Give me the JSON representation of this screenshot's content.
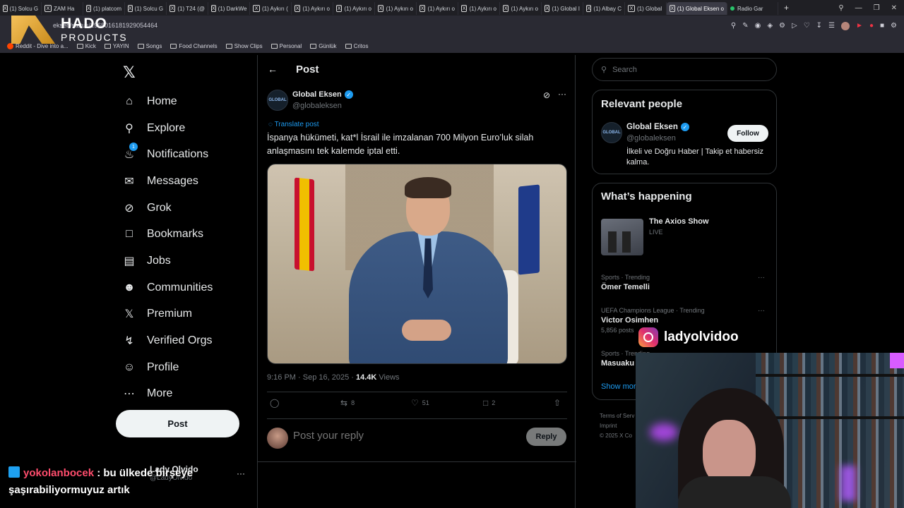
{
  "browser": {
    "tabs": [
      {
        "label": "(1) Solcu G"
      },
      {
        "label": "ZAM Ha"
      },
      {
        "label": "(1) platcom"
      },
      {
        "label": "(1) Solcu G"
      },
      {
        "label": "(1) T24 (@"
      },
      {
        "label": "(1) DarkWe"
      },
      {
        "label": "(1) Aykırı ("
      },
      {
        "label": "(1) Aykırı o"
      },
      {
        "label": "(1) Aykırı o"
      },
      {
        "label": "(1) Aykırı o"
      },
      {
        "label": "(1) Aykırı o"
      },
      {
        "label": "(1) Aykırı o"
      },
      {
        "label": "(1) Aykırı o"
      },
      {
        "label": "(1) Global I"
      },
      {
        "label": "(1) Albay C"
      },
      {
        "label": "(1) Global"
      },
      {
        "label": "(1) Global Eksen o"
      },
      {
        "label": "Radio Gar"
      }
    ],
    "url": "eksen/status/1968016181929054464",
    "bookmarks": [
      "Reddit - Dive into a...",
      "Kick",
      "YAYIN",
      "Songs",
      "Food Channels",
      "Show Clips",
      "Personal",
      "Günlük",
      "Critos"
    ]
  },
  "logo": {
    "line1": "HADO",
    "line2": "PRODUCTS"
  },
  "nav": {
    "items": [
      {
        "label": "Home",
        "icon": "home-icon"
      },
      {
        "label": "Explore",
        "icon": "search-icon"
      },
      {
        "label": "Notifications",
        "icon": "bell-icon"
      },
      {
        "label": "Messages",
        "icon": "envelope-icon"
      },
      {
        "label": "Grok",
        "icon": "grok-icon"
      },
      {
        "label": "Bookmarks",
        "icon": "bookmark-icon"
      },
      {
        "label": "Jobs",
        "icon": "briefcase-icon"
      },
      {
        "label": "Communities",
        "icon": "people-icon"
      },
      {
        "label": "Premium",
        "icon": "x-icon"
      },
      {
        "label": "Verified Orgs",
        "icon": "bolt-icon"
      },
      {
        "label": "Profile",
        "icon": "person-icon"
      },
      {
        "label": "More",
        "icon": "more-circle-icon"
      }
    ],
    "notification_count": "1",
    "post_button": "Post",
    "account": {
      "name": "Lady Olvido",
      "handle": "@LadyOlvido"
    }
  },
  "post": {
    "header_title": "Post",
    "author_name": "Global Eksen",
    "author_handle": "@globaleksen",
    "avatar_text": "GLOBAL",
    "translate_label": "Translate post",
    "text": "İspanya hükümeti, kat*l İsrail ile imzalanan 700 Milyon Euro’luk silah anlaşmasını tek kalemde iptal etti.",
    "time": "9:16 PM · Sep 16, 2025 · ",
    "views_count": "14.4K",
    "views_label": " Views",
    "replies": "",
    "reposts": "8",
    "likes": "51",
    "bookmarks": "2",
    "reply_placeholder": "Post your reply",
    "reply_button": "Reply"
  },
  "sidebar": {
    "search_placeholder": "Search",
    "relevant_title": "Relevant people",
    "person": {
      "name": "Global Eksen",
      "handle": "@globaleksen",
      "bio": "İlkeli ve Doğru Haber | Takip et habersiz kalma.",
      "follow_label": "Follow"
    },
    "happening_title": "What’s happening",
    "live_show": {
      "title": "The Axios Show",
      "status": "LIVE"
    },
    "trends": [
      {
        "category": "Sports · Trending",
        "name": "Ömer Temelli",
        "count": ""
      },
      {
        "category": "UEFA Champions League · Trending",
        "name": "Victor Osimhen",
        "count": "5,856 posts"
      },
      {
        "category": "Sports · Trending",
        "name": "Masuaku",
        "count": ""
      }
    ],
    "show_more": "Show more",
    "footer": [
      "Terms of Serv",
      "Imprint",
      "© 2025 X Co"
    ]
  },
  "overlay": {
    "instagram_handle": "ladyolvidoo",
    "chat_user": "yokolanbocek",
    "chat_message": " : bu ülkede birşeye şaşırabiliyormuyuz artık"
  }
}
